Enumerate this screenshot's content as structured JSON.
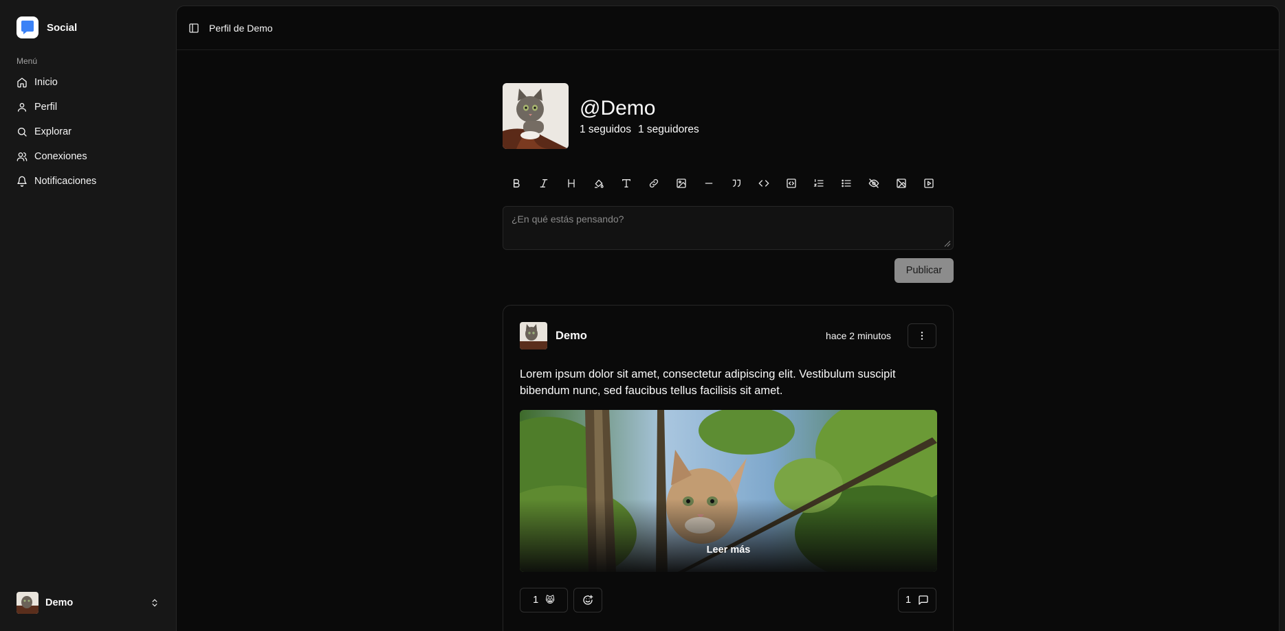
{
  "app": {
    "name": "Social",
    "brand_color": "#3b82f6"
  },
  "sidebar": {
    "menu_label": "Menú",
    "items": [
      {
        "label": "Inicio",
        "icon": "home-icon"
      },
      {
        "label": "Perfil",
        "icon": "user-icon"
      },
      {
        "label": "Explorar",
        "icon": "search-icon"
      },
      {
        "label": "Conexiones",
        "icon": "users-icon"
      },
      {
        "label": "Notificaciones",
        "icon": "bell-icon"
      }
    ],
    "user": {
      "name": "Demo"
    }
  },
  "header": {
    "title": "Perfil de Demo"
  },
  "profile": {
    "handle": "@Demo",
    "following": "1 seguidos",
    "followers": "1 seguidores"
  },
  "editor": {
    "tools": [
      "bold-icon",
      "italic-icon",
      "heading-icon",
      "highlight-icon",
      "text-icon",
      "link-icon",
      "image-icon",
      "horizontal-rule-icon",
      "quote-icon",
      "code-icon",
      "code-block-icon",
      "ordered-list-icon",
      "bullet-list-icon",
      "spoiler-icon",
      "hide-image-icon",
      "video-icon"
    ],
    "placeholder": "¿En qué estás pensando?",
    "publish_label": "Publicar"
  },
  "post": {
    "author": "Demo",
    "time": "hace 2 minutos",
    "text": "Lorem ipsum dolor sit amet, consectetur adipiscing elit. Vestibulum suscipit bibendum nunc, sed faucibus tellus facilisis sit amet.",
    "read_more": "Leer más",
    "reaction_count": "1",
    "reaction_emoji": "😸",
    "comment_count": "1"
  }
}
